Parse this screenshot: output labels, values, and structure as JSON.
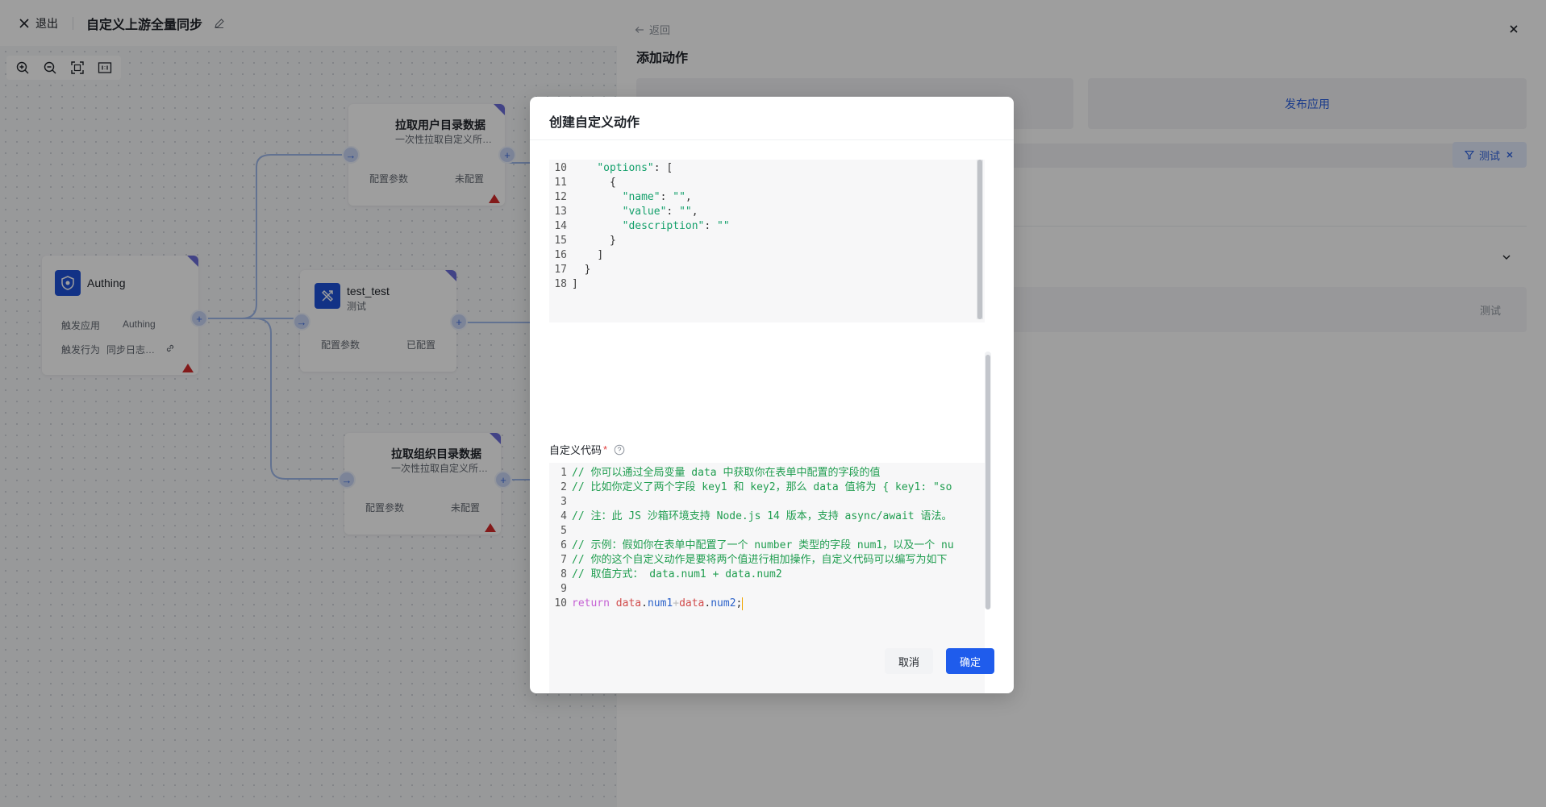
{
  "header": {
    "exit_label": "退出",
    "flow_title": "自定义上游全量同步"
  },
  "canvas": {
    "nodes": {
      "authing": {
        "title": "Authing",
        "row1_label": "触发应用",
        "row1_value": "Authing",
        "row2_label": "触发行为",
        "row2_value": "同步日志…"
      },
      "user_dir": {
        "title": "拉取用户目录数据",
        "subtitle": "一次性拉取自定义所…",
        "row_label": "配置参数",
        "row_value": "未配置"
      },
      "test": {
        "title": "test_test",
        "subtitle": "测试",
        "row_label": "配置参数",
        "row_value": "已配置"
      },
      "org_dir": {
        "title": "拉取组织目录数据",
        "subtitle": "一次性拉取自定义所…",
        "row_label": "配置参数",
        "row_value": "未配置"
      }
    }
  },
  "drawer": {
    "back_label": "返回",
    "title": "添加动作",
    "cards": [
      "",
      "发布应用"
    ],
    "filter_tag": "测试",
    "test_row_label": "测试"
  },
  "modal": {
    "title": "创建自定义动作",
    "code_label": "自定义代码",
    "required_mark": "*",
    "cancel_label": "取消",
    "confirm_label": "确定"
  },
  "json_editor": {
    "lines": [
      {
        "n": "10",
        "indent": "    ",
        "segments": [
          [
            "json-str",
            "\"options\""
          ],
          [
            "json-p",
            ": ["
          ]
        ]
      },
      {
        "n": "11",
        "indent": "      ",
        "segments": [
          [
            "json-p",
            "{"
          ]
        ]
      },
      {
        "n": "12",
        "indent": "        ",
        "segments": [
          [
            "json-str",
            "\"name\""
          ],
          [
            "json-p",
            ": "
          ],
          [
            "json-str",
            "\"\""
          ],
          [
            "json-p",
            ","
          ]
        ]
      },
      {
        "n": "13",
        "indent": "        ",
        "segments": [
          [
            "json-str",
            "\"value\""
          ],
          [
            "json-p",
            ": "
          ],
          [
            "json-str",
            "\"\""
          ],
          [
            "json-p",
            ","
          ]
        ]
      },
      {
        "n": "14",
        "indent": "        ",
        "segments": [
          [
            "json-str",
            "\"description\""
          ],
          [
            "json-p",
            ": "
          ],
          [
            "json-str",
            "\"\""
          ]
        ]
      },
      {
        "n": "15",
        "indent": "      ",
        "segments": [
          [
            "json-p",
            "}"
          ]
        ]
      },
      {
        "n": "16",
        "indent": "    ",
        "segments": [
          [
            "json-p",
            "]"
          ]
        ]
      },
      {
        "n": "17",
        "indent": "  ",
        "segments": [
          [
            "json-p",
            "}"
          ]
        ]
      },
      {
        "n": "18",
        "indent": "",
        "segments": [
          [
            "json-p",
            "]"
          ]
        ]
      }
    ]
  },
  "code_editor": {
    "lines": [
      {
        "n": "1",
        "segments": [
          [
            "cmt",
            "// 你可以通过全局变量 data 中获取你在表单中配置的字段的值"
          ]
        ]
      },
      {
        "n": "2",
        "segments": [
          [
            "cmt",
            "// 比如你定义了两个字段 key1 和 key2，那么 data 值将为 { key1: \"so"
          ]
        ]
      },
      {
        "n": "3",
        "segments": []
      },
      {
        "n": "4",
        "segments": [
          [
            "cmt",
            "// 注：此 JS 沙箱环境支持 Node.js 14 版本，支持 async/await 语法。"
          ]
        ]
      },
      {
        "n": "5",
        "segments": []
      },
      {
        "n": "6",
        "segments": [
          [
            "cmt",
            "// 示例：假如你在表单中配置了一个 number 类型的字段 num1，以及一个 nu"
          ]
        ]
      },
      {
        "n": "7",
        "segments": [
          [
            "cmt",
            "// 你的这个自定义动作是要将两个值进行相加操作，自定义代码可以编写为如下"
          ]
        ]
      },
      {
        "n": "8",
        "segments": [
          [
            "cmt",
            "// 取值方式： data.num1 + data.num2"
          ]
        ]
      },
      {
        "n": "9",
        "segments": []
      },
      {
        "n": "10",
        "segments": [
          [
            "kw",
            "return"
          ],
          [
            "json-p",
            " "
          ],
          [
            "var",
            "data"
          ],
          [
            "json-p",
            "."
          ],
          [
            "prop",
            "num1"
          ],
          [
            "plus",
            "+"
          ],
          [
            "var",
            "data"
          ],
          [
            "json-p",
            "."
          ],
          [
            "prop",
            "num2"
          ],
          [
            "json-p",
            ";"
          ]
        ]
      }
    ]
  },
  "icons": {
    "close": "close-icon",
    "edit": "pencil-icon",
    "zoom_in": "zoom-in-icon",
    "zoom_out": "zoom-out-icon",
    "fit": "fit-screen-icon",
    "actual_size": "actual-size-icon",
    "filter": "filter-icon",
    "help": "help-circle-icon",
    "chevron": "chevron-down-icon",
    "link": "link-icon"
  },
  "colors": {
    "primary": "#1f5cec",
    "node_corner": "#6b6dd8",
    "warning": "#d42b2b",
    "comment": "#1f9d4f"
  }
}
